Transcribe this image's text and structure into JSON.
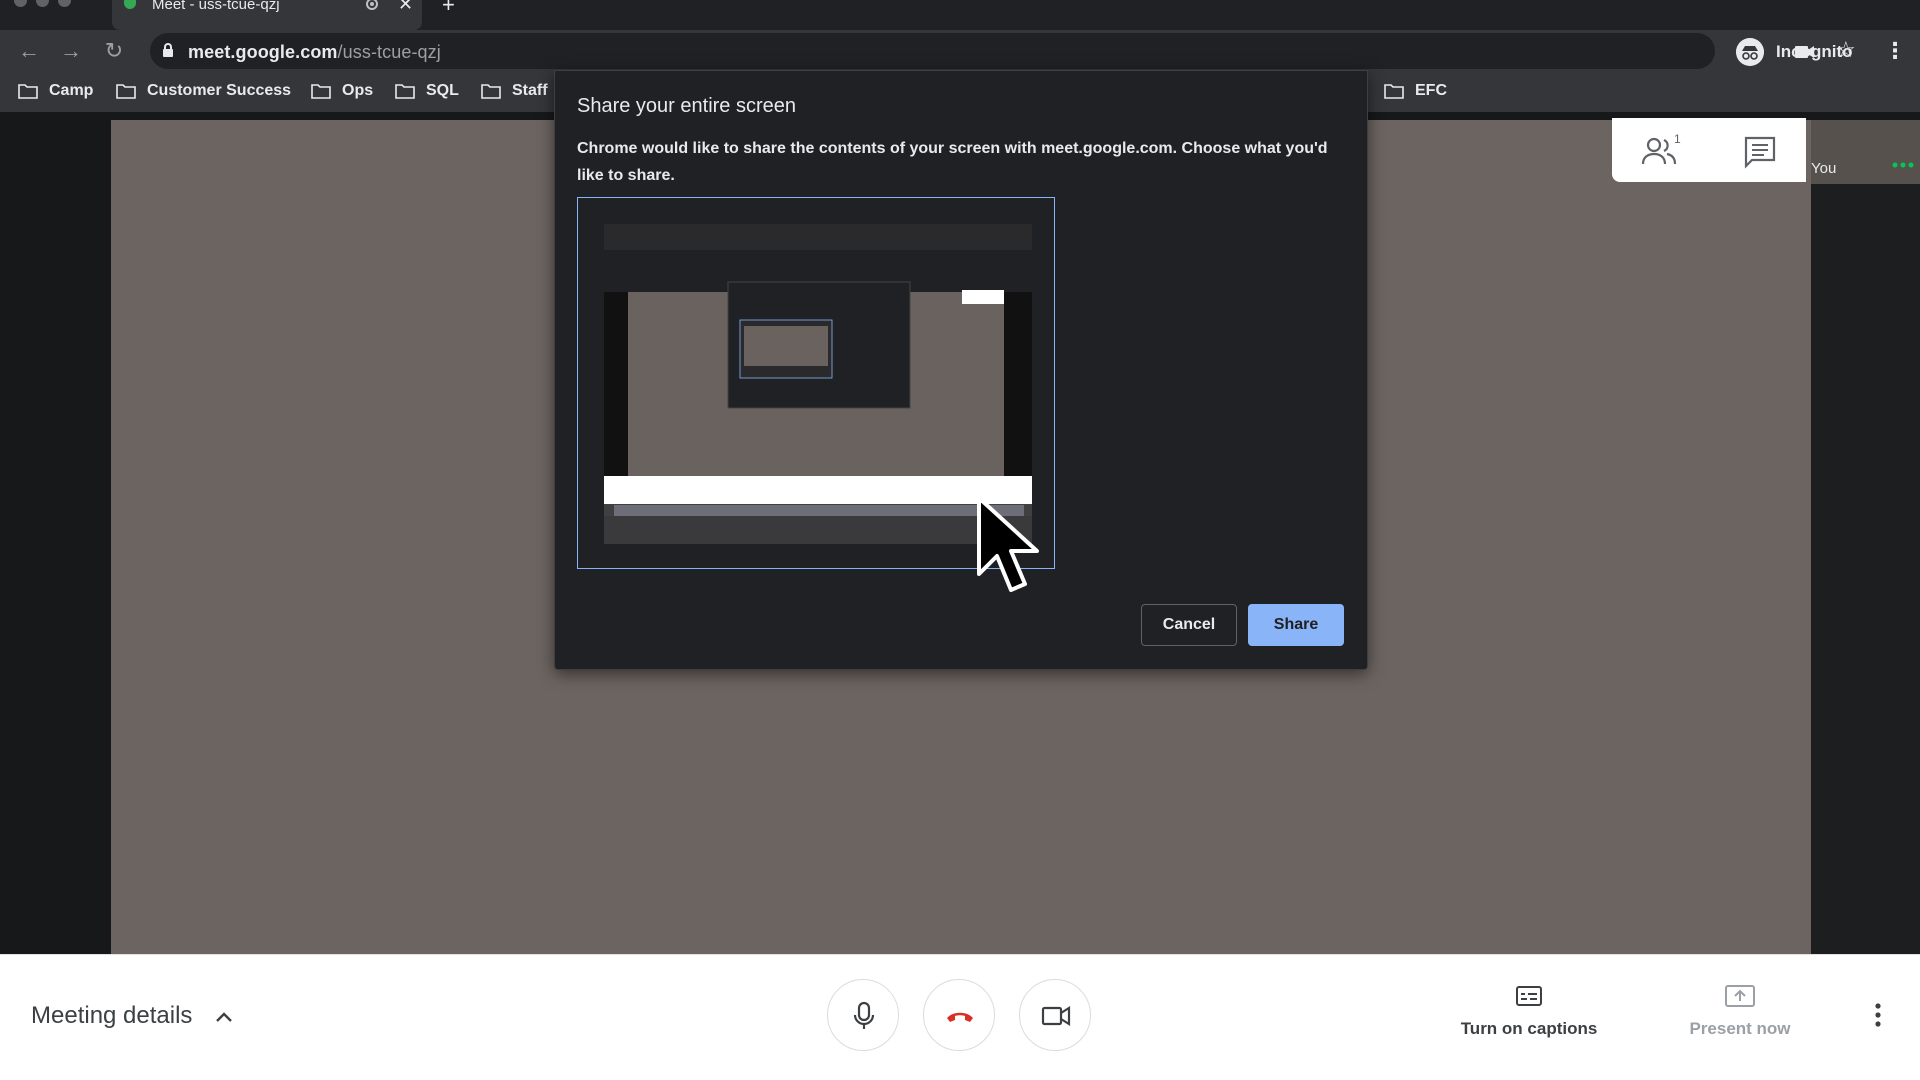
{
  "browser": {
    "tab": {
      "title": "Meet - uss-tcue-qzj",
      "close_glyph": "✕"
    },
    "new_tab_glyph": "+",
    "nav": {
      "back_glyph": "←",
      "forward_glyph": "→",
      "reload_glyph": "↻"
    },
    "url": {
      "host": "meet.google.com",
      "path": "/uss-tcue-qzj"
    },
    "profile_label": "Incognito",
    "menu_glyph": "⋮",
    "star_glyph": "☆"
  },
  "bookmarks": [
    {
      "label": "Camp"
    },
    {
      "label": "Customer Success"
    },
    {
      "label": "Ops"
    },
    {
      "label": "SQL"
    },
    {
      "label": "Staff"
    },
    {
      "label": "EFC"
    }
  ],
  "meet": {
    "self_tile_label": "You",
    "participant_count": "1"
  },
  "dialog": {
    "title": "Share your entire screen",
    "description": "Chrome would like to share the contents of your screen with meet.google.com. Choose what you'd like to share.",
    "cancel_label": "Cancel",
    "share_label": "Share"
  },
  "bottom_bar": {
    "meeting_details_label": "Meeting details",
    "captions_label": "Turn on captions",
    "present_label": "Present now"
  },
  "colors": {
    "accent": "#8ab4f8",
    "hangup_red": "#d93025",
    "chrome_dark": "#35363a"
  }
}
